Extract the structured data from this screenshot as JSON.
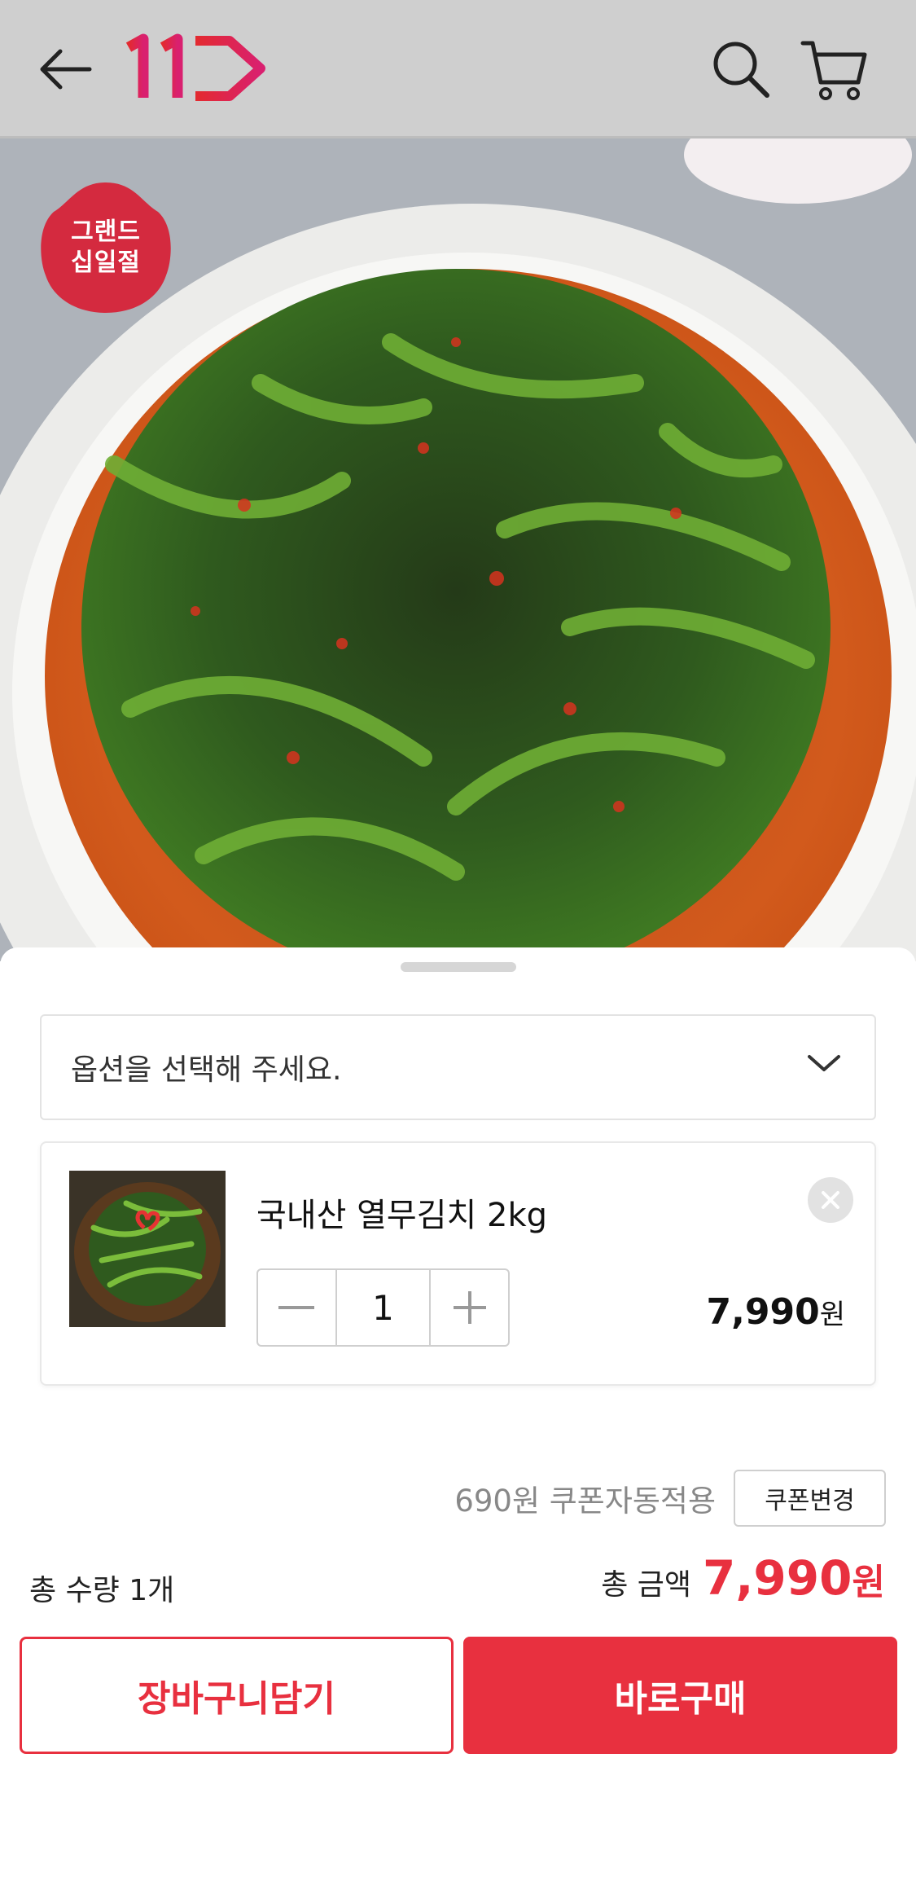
{
  "header": {
    "back_icon": "arrow-left-icon",
    "logo_icon": "11st-logo-icon",
    "search_icon": "search-icon",
    "cart_icon": "cart-icon",
    "brand_color": "#d4263b"
  },
  "hero": {
    "badge_line1": "그랜드",
    "badge_line2": "십일절",
    "badge_color": "#d42a3f"
  },
  "sheet": {
    "option_placeholder": "옵션을 선택해 주세요.",
    "item": {
      "name": "국내산 열무김치 2kg",
      "quantity": "1",
      "price": "7,990",
      "currency": "원"
    },
    "coupon": {
      "text": "690원 쿠폰자동적용",
      "change_label": "쿠폰변경"
    },
    "total_quantity": "총 수량 1개",
    "total_label": "총 금액",
    "total_price": "7,990",
    "total_currency": "원",
    "add_to_cart_label": "장바구니담기",
    "buy_now_label": "바로구매",
    "accent_color": "#e8303f"
  }
}
